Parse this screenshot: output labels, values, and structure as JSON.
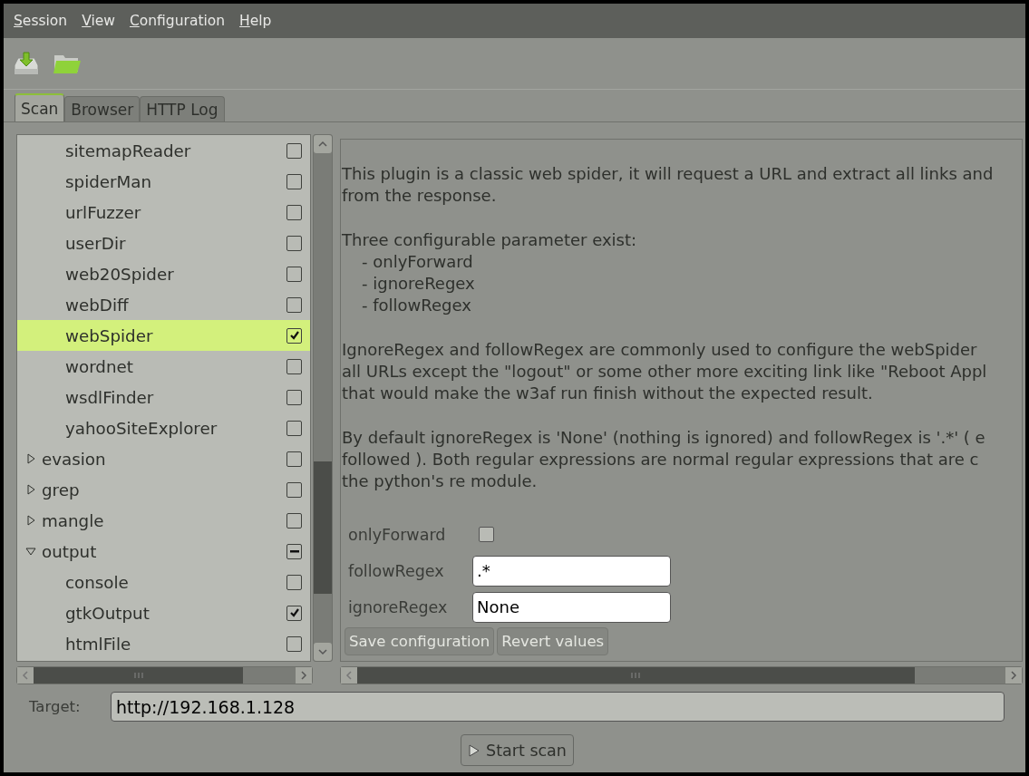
{
  "menu": [
    "Session",
    "View",
    "Configuration",
    "Help"
  ],
  "tabs": [
    {
      "label": "Scan",
      "selected": true
    },
    {
      "label": "Browser",
      "selected": false
    },
    {
      "label": "HTTP Log",
      "selected": false
    }
  ],
  "tree": {
    "scrolled_group_children": [
      {
        "label": "sitemapReader",
        "checked": false,
        "selected": false
      },
      {
        "label": "spiderMan",
        "checked": false,
        "selected": false
      },
      {
        "label": "urlFuzzer",
        "checked": false,
        "selected": false
      },
      {
        "label": "userDir",
        "checked": false,
        "selected": false
      },
      {
        "label": "web20Spider",
        "checked": false,
        "selected": false
      },
      {
        "label": "webDiff",
        "checked": false,
        "selected": false
      },
      {
        "label": "webSpider",
        "checked": true,
        "selected": true
      },
      {
        "label": "wordnet",
        "checked": false,
        "selected": false
      },
      {
        "label": "wsdlFinder",
        "checked": false,
        "selected": false
      },
      {
        "label": "yahooSiteExplorer",
        "checked": false,
        "selected": false
      }
    ],
    "groups": [
      {
        "label": "evasion",
        "checked": false,
        "indeterminate": false,
        "expanded": false,
        "selected": false
      },
      {
        "label": "grep",
        "checked": false,
        "indeterminate": false,
        "expanded": false,
        "selected": false
      },
      {
        "label": "mangle",
        "checked": false,
        "indeterminate": false,
        "expanded": false,
        "selected": false
      },
      {
        "label": "output",
        "checked": false,
        "indeterminate": true,
        "expanded": true,
        "selected": false,
        "children": [
          {
            "label": "console",
            "checked": false,
            "selected": false
          },
          {
            "label": "gtkOutput",
            "checked": true,
            "selected": false
          },
          {
            "label": "htmlFile",
            "checked": false,
            "selected": false
          }
        ]
      }
    ]
  },
  "description": [
    [
      "This plugin is a classic web spider, it will request a URL and extract all links and",
      "from the response."
    ],
    [
      "Three configurable parameter exist:",
      "- onlyForward",
      "- ignoreRegex",
      "- followRegex"
    ],
    [
      "IgnoreRegex and followRegex are commonly used to configure the webSpider",
      "all URLs except the \"logout\" or some other more exciting link like \"Reboot Appl",
      "that would make the w3af run finish without the expected result."
    ],
    [
      "By default ignoreRegex is 'None' (nothing is ignored) and followRegex is '.*' ( e",
      "followed ). Both regular expressions are normal regular expressions that are c",
      "the python's re module."
    ]
  ],
  "options": [
    {
      "kind": "checkbox",
      "label": "onlyForward",
      "checked": false
    },
    {
      "kind": "text",
      "label": "followRegex",
      "value": ".*"
    },
    {
      "kind": "text",
      "label": "ignoreRegex",
      "value": "None"
    }
  ],
  "config_buttons": [
    {
      "label": "Save configuration",
      "disabled": true
    },
    {
      "label": "Revert values",
      "disabled": true
    }
  ],
  "target": {
    "label": "Target:",
    "value": "http://192.168.1.128"
  },
  "start_button": {
    "label": "Start scan"
  }
}
